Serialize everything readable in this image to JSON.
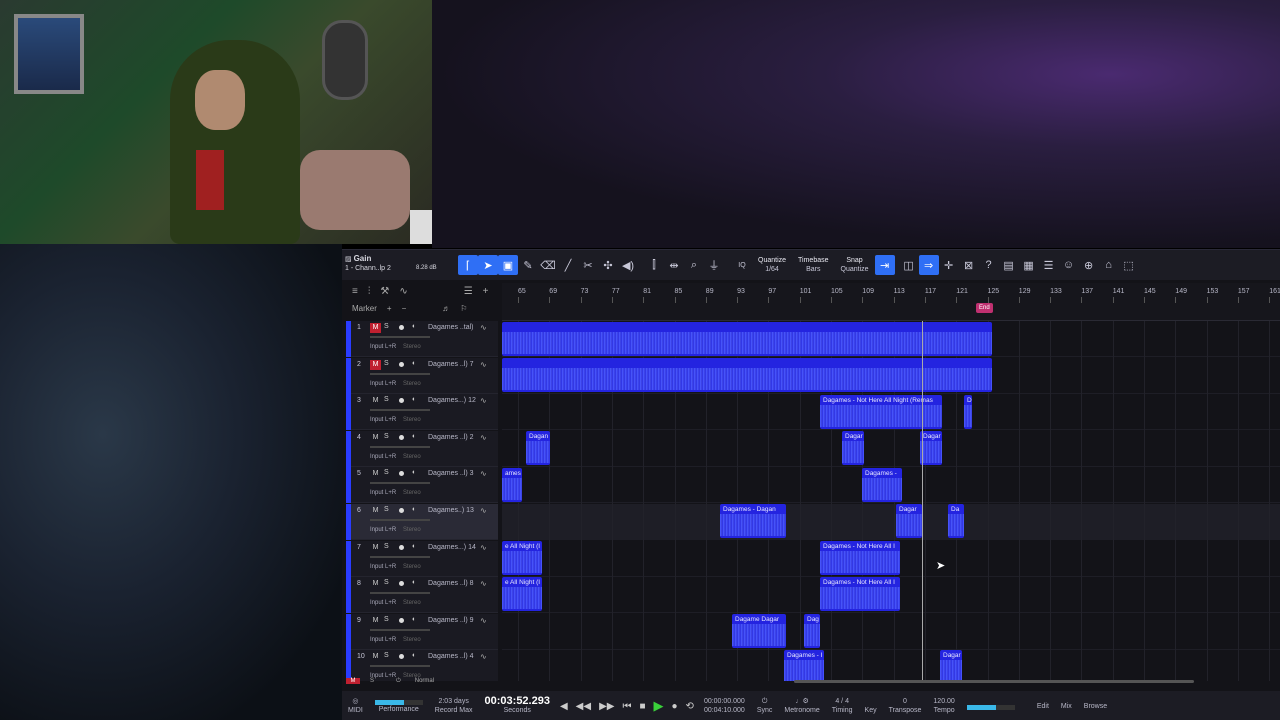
{
  "toolbar": {
    "selected_param": "Gain",
    "channel": "1 - Chann..lp 2",
    "gain_value": "8.28 dB",
    "quantize_label": "Quantize",
    "quantize_value": "1/64",
    "timebase_label": "Timebase",
    "timebase_value": "Bars",
    "snap_label": "Snap",
    "snap_value": "Quantize",
    "iq_label": "IQ"
  },
  "subheader": {
    "marker_label": "Marker"
  },
  "ruler": {
    "bars": [
      "65",
      "69",
      "73",
      "77",
      "81",
      "85",
      "89",
      "93",
      "97",
      "101",
      "105",
      "109",
      "113",
      "117",
      "121",
      "125",
      "129",
      "133",
      "137",
      "141",
      "145",
      "149",
      "153",
      "157",
      "161"
    ],
    "end_label": "End"
  },
  "tracks": [
    {
      "num": "1",
      "mute_on": true,
      "name": "Dagames ..tal)",
      "input": "Input L+R",
      "stereo": "Stereo"
    },
    {
      "num": "2",
      "mute_on": true,
      "name": "Dagames ..l) 7",
      "input": "Input L+R",
      "stereo": "Stereo"
    },
    {
      "num": "3",
      "mute_on": false,
      "name": "Dagames...) 12",
      "input": "Input L+R",
      "stereo": "Stereo"
    },
    {
      "num": "4",
      "mute_on": false,
      "name": "Dagames ..l) 2",
      "input": "Input L+R",
      "stereo": "Stereo"
    },
    {
      "num": "5",
      "mute_on": false,
      "name": "Dagames ..l) 3",
      "input": "Input L+R",
      "stereo": "Stereo"
    },
    {
      "num": "6",
      "mute_on": false,
      "name": "Dagames..) 13",
      "input": "Input L+R",
      "stereo": "Stereo",
      "selected": true
    },
    {
      "num": "7",
      "mute_on": false,
      "name": "Dagames...) 14",
      "input": "Input L+R",
      "stereo": "Stereo"
    },
    {
      "num": "8",
      "mute_on": false,
      "name": "Dagames ..l) 8",
      "input": "Input L+R",
      "stereo": "Stereo"
    },
    {
      "num": "9",
      "mute_on": false,
      "name": "Dagames ..l) 9",
      "input": "Input L+R",
      "stereo": "Stereo"
    },
    {
      "num": "10",
      "mute_on": false,
      "name": "Dagames ..l) 4",
      "input": "Input L+R",
      "stereo": "Stereo"
    }
  ],
  "clip_titles": {
    "c3a": "Dagames - Not Here All Night (Remas",
    "c3b": "D",
    "c4a": "Dagan",
    "c4b": "Dagar",
    "c4c": "Dagar",
    "c5a": "ames",
    "c5b": "Dagames -",
    "c6a": "Dagames - Dagan",
    "c6b": "Dagar",
    "c6c": "Da",
    "c7a": "e All Night (I",
    "c7b": "Dagames - Not Here All I",
    "c8a": "e All Night (I",
    "c8b": "Dagames - Not Here All I",
    "c9a": "Dagame Dagar",
    "c9b": "Dag",
    "c10a": "Dagames - I",
    "c10b": "Dagar"
  },
  "footer": {
    "m": "M",
    "s": "S",
    "mode": "Normal"
  },
  "transport": {
    "midi": "MIDI",
    "performance": "Performance",
    "record_days": "2:03 days",
    "record_max": "Record Max",
    "time": "00:03:52.293",
    "time_unit": "Seconds",
    "loop_start": "00:00:00.000",
    "loop_end": "00:04:10.000",
    "sync": "Sync",
    "metronome": "Metronome",
    "timing_value": "4 / 4",
    "timing": "Timing",
    "key": "Key",
    "transpose_value": "0",
    "transpose": "Transpose",
    "tempo_value": "120.00",
    "tempo": "Tempo",
    "edit": "Edit",
    "mix": "Mix",
    "browse": "Browse"
  }
}
